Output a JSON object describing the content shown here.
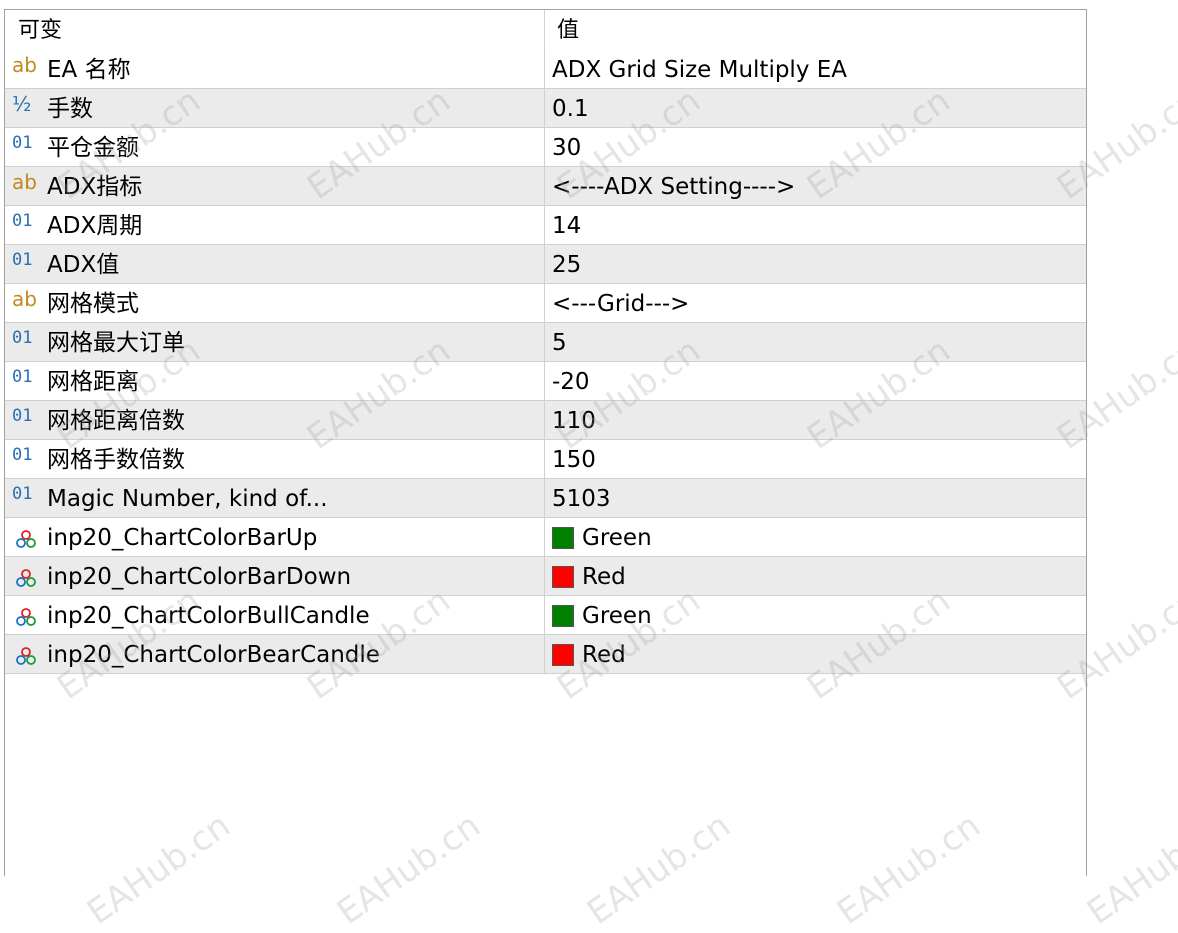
{
  "header": {
    "name_col": "可变",
    "value_col": "值"
  },
  "rows": [
    {
      "type": "ab",
      "name": "EA 名称",
      "value": "ADX Grid Size Multiply EA"
    },
    {
      "type": "dbl",
      "name": "手数",
      "value": "0.1"
    },
    {
      "type": "int",
      "name": "平仓金额",
      "value": "30"
    },
    {
      "type": "ab",
      "name": "ADX指标",
      "value": "<----ADX Setting---->"
    },
    {
      "type": "int",
      "name": "ADX周期",
      "value": "14"
    },
    {
      "type": "int",
      "name": "ADX值",
      "value": "25"
    },
    {
      "type": "ab",
      "name": "网格模式",
      "value": "<---Grid--->"
    },
    {
      "type": "int",
      "name": "网格最大订单",
      "value": "5"
    },
    {
      "type": "int",
      "name": "网格距离",
      "value": "-20"
    },
    {
      "type": "int",
      "name": "网格距离倍数",
      "value": "110"
    },
    {
      "type": "int",
      "name": "网格手数倍数",
      "value": "150"
    },
    {
      "type": "int",
      "name": "Magic Number, kind of...",
      "value": "5103"
    },
    {
      "type": "color",
      "name": "inp20_ChartColorBarUp",
      "value": "Green",
      "swatch": "#008000"
    },
    {
      "type": "color",
      "name": "inp20_ChartColorBarDown",
      "value": "Red",
      "swatch": "#ff0000"
    },
    {
      "type": "color",
      "name": "inp20_ChartColorBullCandle",
      "value": "Green",
      "swatch": "#008000"
    },
    {
      "type": "color",
      "name": "inp20_ChartColorBearCandle",
      "value": "Red",
      "swatch": "#ff0000"
    }
  ],
  "icons": {
    "ab": "ab",
    "int": "01",
    "dbl": "½",
    "color": "color-circles-icon"
  },
  "watermark": "EAHub.cn"
}
